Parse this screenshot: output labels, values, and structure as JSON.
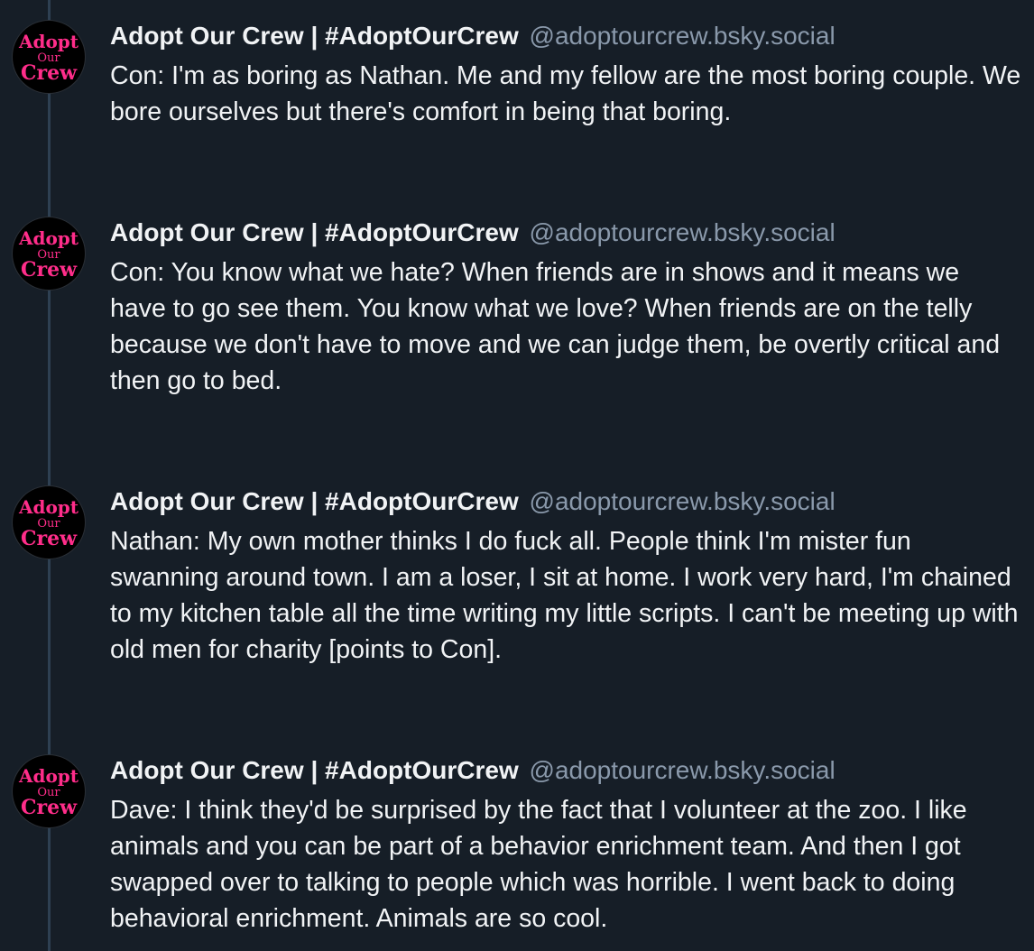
{
  "account": {
    "display_name": "Adopt Our Crew | #AdoptOurCrew",
    "handle": "@adoptourcrew.bsky.social",
    "avatar_icon": "adopt-our-crew-logo-icon",
    "avatar_logo_lines": [
      "Adopt",
      "Our",
      "Crew"
    ],
    "avatar_logo_color": "#ff2d8a",
    "avatar_bg": "#000000"
  },
  "colors": {
    "background": "#161e27",
    "thread_line": "#2e4052",
    "text_primary": "#f1f3f5",
    "text_secondary": "#8a99ab"
  },
  "posts": [
    {
      "display_name": "Adopt Our Crew | #AdoptOurCrew",
      "handle": "@adoptourcrew.bsky.social",
      "text": "Con: I'm as boring as Nathan. Me and my fellow are the most boring couple. We bore ourselves but there's comfort in being that boring."
    },
    {
      "display_name": "Adopt Our Crew | #AdoptOurCrew",
      "handle": "@adoptourcrew.bsky.social",
      "text": "Con: You know what we hate? When friends are in shows and it means we have to go see them. You know what we love? When friends are on the telly because we don't have to move and we can judge them, be overtly critical and then go to bed."
    },
    {
      "display_name": "Adopt Our Crew | #AdoptOurCrew",
      "handle": "@adoptourcrew.bsky.social",
      "text": "Nathan: My own mother thinks I do fuck all. People think I'm mister fun swanning around town. I am a loser, I sit at home. I work very hard, I'm chained to my kitchen table all the time writing my little scripts. I can't be meeting up with old men for charity [points to Con]."
    },
    {
      "display_name": "Adopt Our Crew | #AdoptOurCrew",
      "handle": "@adoptourcrew.bsky.social",
      "text": "Dave: I think they'd be surprised by the fact that I volunteer at the zoo. I like animals and you can be part of a behavior enrichment team. And then I got swapped over to talking to people which was horrible. I went back to doing behavioral enrichment. Animals are so cool."
    }
  ]
}
